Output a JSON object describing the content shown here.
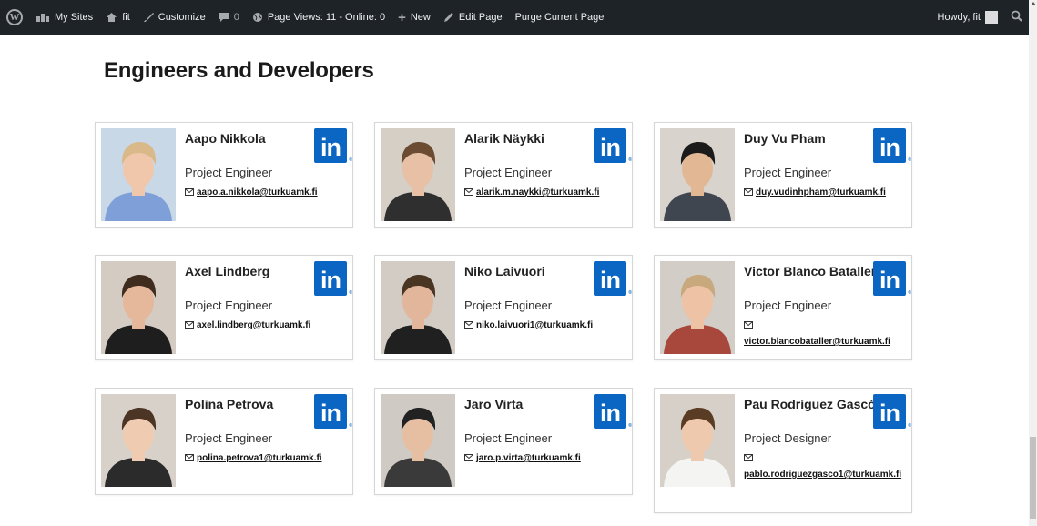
{
  "adminbar": {
    "my_sites": "My Sites",
    "site": "fit",
    "customize": "Customize",
    "comments": "0",
    "page_views": "Page Views: 11 - Online: 0",
    "new": "New",
    "edit_page": "Edit Page",
    "purge": "Purge Current Page",
    "howdy": "Howdy, fit"
  },
  "page": {
    "title": "Engineers and Developers"
  },
  "linkedin_text": "in",
  "people": [
    {
      "name": "Aapo Nikkola",
      "role": "Project Engineer",
      "email": "aapo.a.nikkola@turkuamk.fi",
      "bg": "#c9d8e6",
      "hair": "#d9b98a",
      "skin": "#f0c7ab",
      "shirt": "#7f9fd8"
    },
    {
      "name": "Alarik Näykki",
      "role": "Project Engineer",
      "email": "alarik.m.naykki@turkuamk.fi",
      "bg": "#d6cfc6",
      "hair": "#6b4c33",
      "skin": "#e7c0a5",
      "shirt": "#2f2f2f"
    },
    {
      "name": "Duy Vu Pham",
      "role": "Project Engineer",
      "email": "duy.vudinhpham@turkuamk.fi",
      "bg": "#d8d3cc",
      "hair": "#1b1b1b",
      "skin": "#e2b894",
      "shirt": "#3f4650"
    },
    {
      "name": "Axel Lindberg",
      "role": "Project Engineer",
      "email": "axel.lindberg@turkuamk.fi",
      "bg": "#d4ccc2",
      "hair": "#3f2c1f",
      "skin": "#e5b79b",
      "shirt": "#1e1e1e"
    },
    {
      "name": "Niko Laivuori",
      "role": "Project Engineer",
      "email": "niko.laivuori1@turkuamk.fi",
      "bg": "#d3ccc5",
      "hair": "#4a3422",
      "skin": "#e2b69a",
      "shirt": "#202020"
    },
    {
      "name": "Victor Blanco Bataller",
      "role": "Project Engineer",
      "email": "victor.blancobataller@turkuamk.fi",
      "bg": "#d2cdc6",
      "hair": "#c8a97d",
      "skin": "#eec3a5",
      "shirt": "#a8473b"
    },
    {
      "name": "Polina Petrova",
      "role": "Project Engineer",
      "email": "polina.petrova1@turkuamk.fi",
      "bg": "#d7d1ca",
      "hair": "#4d3526",
      "skin": "#efcbb1",
      "shirt": "#2b2b2b"
    },
    {
      "name": "Jaro Virta",
      "role": "Project Engineer",
      "email": "jaro.p.virta@turkuamk.fi",
      "bg": "#cfcac3",
      "hair": "#222222",
      "skin": "#e6bfa3",
      "shirt": "#3a3a3a"
    },
    {
      "name": "Pau Rodríguez Gascó",
      "role": "Project Designer",
      "email": "pablo.rodriguezgasco1@turkuamk.fi",
      "bg": "#d6d0c9",
      "hair": "#5a3b24",
      "skin": "#efc9ad",
      "shirt": "#f4f4f2"
    }
  ]
}
